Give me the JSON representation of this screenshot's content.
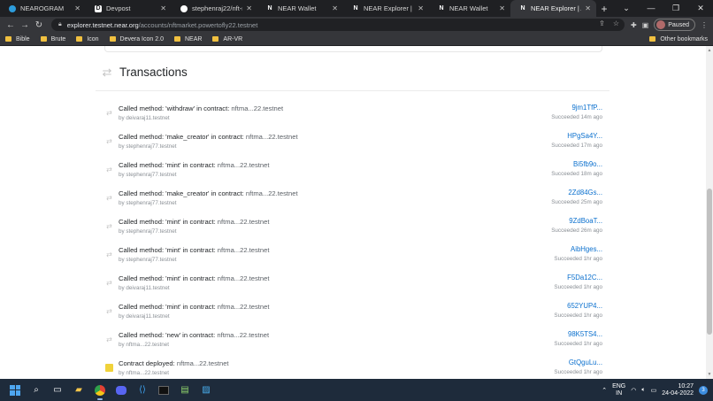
{
  "browser": {
    "tabs": [
      {
        "title": "NEAROGRAM",
        "favicon": "nearogram-favicon",
        "active": false
      },
      {
        "title": "Devpost",
        "favicon": "devpost-favicon",
        "active": false
      },
      {
        "title": "stephenraj22/nft-mar",
        "favicon": "github-favicon",
        "active": false
      },
      {
        "title": "NEAR Wallet",
        "favicon": "near-favicon",
        "active": false
      },
      {
        "title": "NEAR Explorer | Trans",
        "favicon": "near-favicon",
        "active": false
      },
      {
        "title": "NEAR Wallet",
        "favicon": "near-favicon",
        "active": false
      },
      {
        "title": "NEAR Explorer | Accou",
        "favicon": "near-favicon",
        "active": true
      }
    ],
    "new_tab_glyph": "+",
    "address": {
      "host": "explorer.testnet.near.org",
      "path": "/accounts/nftmarket.powertofly22.testnet"
    },
    "profile_status": "Paused",
    "bookmarks": [
      "Bible",
      "Brute",
      "Icon",
      "Devera Icon 2.0",
      "NEAR",
      "AR-VR"
    ],
    "other_bookmarks": "Other bookmarks"
  },
  "section": {
    "title": "Transactions"
  },
  "transactions": [
    {
      "prefix": "Called method: 'withdraw' in contract: ",
      "contract": "nftma...22.testnet",
      "by_prefix": "by ",
      "signer": "deivaraj11.testnet",
      "hash": "9jm1TfP...",
      "status": "Succeeded 14m ago",
      "icon": "arrows-icon"
    },
    {
      "prefix": "Called method: 'make_creator' in contract: ",
      "contract": "nftma...22.testnet",
      "by_prefix": "by ",
      "signer": "stephenraj77.testnet",
      "hash": "HPgSa4Y...",
      "status": "Succeeded 17m ago",
      "icon": "arrows-icon"
    },
    {
      "prefix": "Called method: 'mint' in contract: ",
      "contract": "nftma...22.testnet",
      "by_prefix": "by ",
      "signer": "stephenraj77.testnet",
      "hash": "Bi5fb9o...",
      "status": "Succeeded 18m ago",
      "icon": "arrows-icon"
    },
    {
      "prefix": "Called method: 'make_creator' in contract: ",
      "contract": "nftma...22.testnet",
      "by_prefix": "by ",
      "signer": "stephenraj77.testnet",
      "hash": "2Zd84Gs...",
      "status": "Succeeded 25m ago",
      "icon": "arrows-icon"
    },
    {
      "prefix": "Called method: 'mint' in contract: ",
      "contract": "nftma...22.testnet",
      "by_prefix": "by ",
      "signer": "stephenraj77.testnet",
      "hash": "9ZdBoaT...",
      "status": "Succeeded 26m ago",
      "icon": "arrows-icon"
    },
    {
      "prefix": "Called method: 'mint' in contract: ",
      "contract": "nftma...22.testnet",
      "by_prefix": "by ",
      "signer": "stephenraj77.testnet",
      "hash": "AibHges...",
      "status": "Succeeded 1hr ago",
      "icon": "arrows-icon"
    },
    {
      "prefix": "Called method: 'mint' in contract: ",
      "contract": "nftma...22.testnet",
      "by_prefix": "by ",
      "signer": "deivaraj11.testnet",
      "hash": "F5Da12C...",
      "status": "Succeeded 1hr ago",
      "icon": "arrows-icon"
    },
    {
      "prefix": "Called method: 'mint' in contract: ",
      "contract": "nftma...22.testnet",
      "by_prefix": "by ",
      "signer": "deivaraj11.testnet",
      "hash": "652YUP4...",
      "status": "Succeeded 1hr ago",
      "icon": "arrows-icon"
    },
    {
      "prefix": "Called method: 'new' in contract: ",
      "contract": "nftma...22.testnet",
      "by_prefix": "by ",
      "signer": "nftma...22.testnet",
      "hash": "98K5TS4...",
      "status": "Succeeded 1hr ago",
      "icon": "arrows-icon"
    },
    {
      "prefix": "Contract deployed: ",
      "contract": "nftma...22.testnet",
      "by_prefix": "by ",
      "signer": "nftma...22.testnet",
      "hash": "GtQguLu...",
      "status": "Succeeded 1hr ago",
      "icon": "document-icon"
    }
  ],
  "taskbar": {
    "language": "ENG",
    "region": "IN",
    "time": "10:27",
    "date": "24-04-2022",
    "notification_count": "3"
  },
  "colors": {
    "link": "#0b70ce",
    "tab_bar": "#1f2023",
    "taskbar": "#1e2b3b"
  }
}
